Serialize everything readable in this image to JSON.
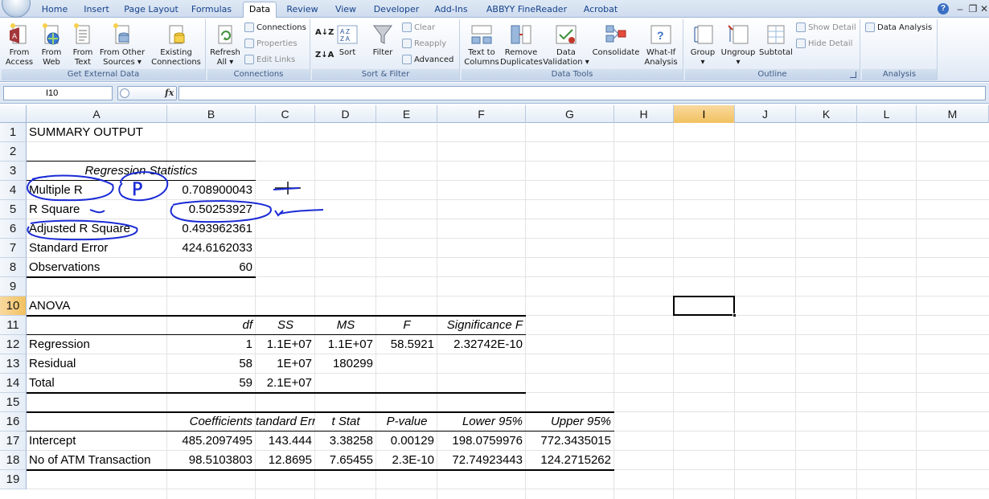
{
  "ribbon_tabs": [
    "Home",
    "Insert",
    "Page Layout",
    "Formulas",
    "Data",
    "Review",
    "View",
    "Developer",
    "Add-Ins",
    "ABBYY FineReader 11",
    "Acrobat"
  ],
  "active_tab": "Data",
  "groups": {
    "get_external": {
      "label": "Get External Data",
      "buttons": [
        {
          "l1": "From",
          "l2": "Access",
          "icon": "access-db-icon"
        },
        {
          "l1": "From",
          "l2": "Web",
          "icon": "web-globe-icon"
        },
        {
          "l1": "From",
          "l2": "Text",
          "icon": "text-file-icon"
        },
        {
          "l1": "From Other",
          "l2": "Sources ▾",
          "icon": "other-sources-icon"
        }
      ],
      "existing": {
        "l1": "Existing",
        "l2": "Connections",
        "icon": "connections-db-icon"
      }
    },
    "connections": {
      "label": "Connections",
      "refresh": {
        "l1": "Refresh",
        "l2": "All ▾",
        "icon": "refresh-icon"
      },
      "connections": "Connections",
      "properties": "Properties",
      "edit_links": "Edit Links"
    },
    "sort_filter": {
      "label": "Sort & Filter",
      "sort": "Sort",
      "filter": "Filter",
      "clear": "Clear",
      "reapply": "Reapply",
      "advanced": "Advanced"
    },
    "data_tools": {
      "label": "Data Tools",
      "buttons": [
        {
          "l1": "Text to",
          "l2": "Columns",
          "icon": "text-to-columns-icon"
        },
        {
          "l1": "Remove",
          "l2": "Duplicates",
          "icon": "remove-duplicates-icon"
        },
        {
          "l1": "Data",
          "l2": "Validation ▾",
          "icon": "data-validation-icon"
        },
        {
          "l1": "Consolidate",
          "l2": "",
          "icon": "consolidate-icon"
        },
        {
          "l1": "What-If",
          "l2": "Analysis ▾",
          "icon": "what-if-icon"
        }
      ]
    },
    "outline": {
      "label": "Outline",
      "buttons": [
        {
          "l1": "Group",
          "l2": "▾",
          "icon": "group-icon"
        },
        {
          "l1": "Ungroup",
          "l2": "▾",
          "icon": "ungroup-icon"
        },
        {
          "l1": "Subtotal",
          "l2": "",
          "icon": "subtotal-icon"
        }
      ],
      "show_detail": "Show Detail",
      "hide_detail": "Hide Detail"
    },
    "analysis": {
      "label": "Analysis",
      "data_analysis": "Data Analysis"
    }
  },
  "formula_bar": {
    "name_box": "I10",
    "fx": "fx",
    "formula": ""
  },
  "columns": [
    "A",
    "B",
    "C",
    "D",
    "E",
    "F",
    "G",
    "H",
    "I",
    "J",
    "K",
    "L",
    "M"
  ],
  "selected_column": "I",
  "rows": [
    "1",
    "2",
    "3",
    "4",
    "5",
    "6",
    "7",
    "8",
    "9",
    "10",
    "11",
    "12",
    "13",
    "14",
    "15",
    "16",
    "17",
    "18",
    "19"
  ],
  "selected_row": "10",
  "cells": {
    "a1": "SUMMARY OUTPUT",
    "reg_stats_header": "Regression Statistics",
    "a4": "Multiple R",
    "b4": "0.708900043",
    "a5": "R Square",
    "b5": "0.50253927",
    "a6": "Adjusted R Square",
    "b6": "0.493962361",
    "a7": "Standard Error",
    "b7": "424.6162033",
    "a8": "Observations",
    "b8": "60",
    "a10": "ANOVA",
    "b11": "df",
    "c11": "SS",
    "d11": "MS",
    "e11": "F",
    "f11": "Significance F",
    "a12": "Regression",
    "b12": "1",
    "c12": "1.1E+07",
    "d12": "1.1E+07",
    "e12": "58.5921",
    "f12": "2.32742E-10",
    "a13": "Residual",
    "b13": "58",
    "c13": "1E+07",
    "d13": "180299",
    "a14": "Total",
    "b14": "59",
    "c14": "2.1E+07",
    "b16": "Coefficients",
    "c16": "tandard Err",
    "d16": "t Stat",
    "e16": "P-value",
    "f16": "Lower 95%",
    "g16": "Upper 95%",
    "a17": "Intercept",
    "b17": "485.2097495",
    "c17": "143.444",
    "d17": "3.38258",
    "e17": "0.00129",
    "f17": "198.0759976",
    "g17": "772.3435015",
    "a18": "No of ATM Transaction",
    "b18": "98.5103803",
    "c18": "12.8695",
    "d18": "7.65455",
    "e18": "2.3E-10",
    "f18": "72.74923443",
    "g18": "124.2715262"
  },
  "ink": {
    "color": "#1a2bd6",
    "annotation_p": "P"
  }
}
